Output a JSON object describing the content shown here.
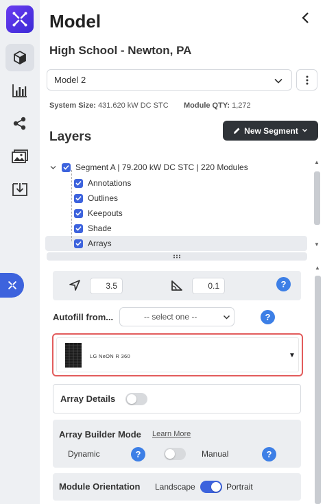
{
  "header": {
    "title": "Model",
    "project": "High School - Newton, PA"
  },
  "model_select": {
    "value": "Model 2"
  },
  "stats": {
    "system_size_label": "System Size:",
    "system_size_value": "431.620 kW DC STC",
    "module_qty_label": "Module QTY:",
    "module_qty_value": "1,272"
  },
  "layers": {
    "heading": "Layers",
    "new_segment_label": "New Segment",
    "items": [
      {
        "label": "Segment A | 79.200 kW DC STC | 220 Modules",
        "checked": true
      },
      {
        "label": "Annotations",
        "checked": true
      },
      {
        "label": "Outlines",
        "checked": true
      },
      {
        "label": "Keepouts",
        "checked": true
      },
      {
        "label": "Shade",
        "checked": true
      },
      {
        "label": "Arrays",
        "checked": true
      }
    ]
  },
  "tools": {
    "azimuth": "3.5",
    "tilt": "0.1"
  },
  "autofill": {
    "label": "Autofill from...",
    "value": "-- select one --"
  },
  "module": {
    "name": "LG NeON R 360"
  },
  "array_details": {
    "label": "Array Details",
    "toggle_on": false
  },
  "array_builder": {
    "label": "Array Builder Mode",
    "learn_more": "Learn More",
    "dynamic_label": "Dynamic",
    "manual_label": "Manual",
    "toggle_on": false
  },
  "module_orientation": {
    "label": "Module Orientation",
    "landscape_label": "Landscape",
    "portrait_label": "Portrait",
    "toggle_on": true
  },
  "colors": {
    "accent": "#3d63dd",
    "highlight_border": "#e25c5c",
    "help": "#3d7fe6"
  }
}
